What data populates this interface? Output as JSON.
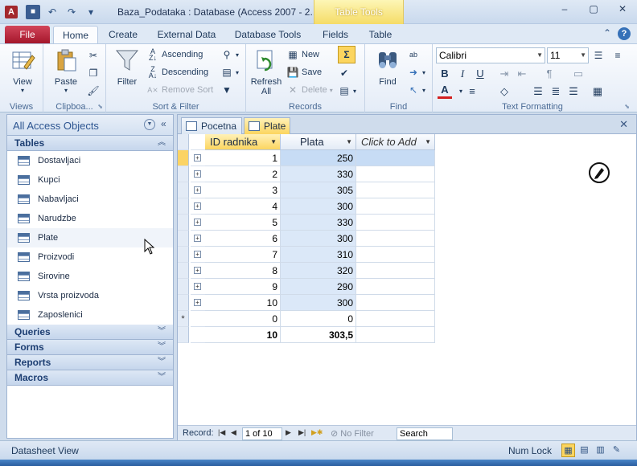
{
  "window": {
    "title": "Baza_Podataka : Database (Access 2007 - 2...",
    "context_tab_group": "Table Tools",
    "controls": {
      "minimize": "–",
      "maximize": "▢",
      "close": "✕"
    }
  },
  "qat": {
    "undo": "↶",
    "redo": "↷",
    "customize": "▾"
  },
  "ribbon_tabs": {
    "file": "File",
    "home": "Home",
    "create": "Create",
    "external_data": "External Data",
    "database_tools": "Database Tools",
    "fields": "Fields",
    "table": "Table"
  },
  "ribbon": {
    "views": {
      "view_label": "View",
      "group": "Views"
    },
    "clipboard": {
      "paste_label": "Paste",
      "group": "Clipboa..."
    },
    "sort_filter": {
      "filter_label": "Filter",
      "ascending": "Ascending",
      "descending": "Descending",
      "remove_sort": "Remove Sort",
      "group": "Sort & Filter"
    },
    "records": {
      "refresh_label": "Refresh",
      "refresh_sub": "All",
      "new": "New",
      "save": "Save",
      "delete": "Delete",
      "group": "Records"
    },
    "find": {
      "find_label": "Find",
      "group": "Find"
    },
    "text_formatting": {
      "font": "Calibri",
      "size": "11",
      "bold": "B",
      "italic": "I",
      "underline": "U",
      "font_color": "A",
      "group": "Text Formatting"
    }
  },
  "nav_pane": {
    "title": "All Access Objects",
    "collapse": "«",
    "sections": {
      "tables": "Tables",
      "queries": "Queries",
      "forms": "Forms",
      "reports": "Reports",
      "macros": "Macros"
    },
    "tables": [
      "Dostavljaci",
      "Kupci",
      "Nabavljaci",
      "Narudzbe",
      "Plate",
      "Proizvodi",
      "Sirovine",
      "Vrsta proizvoda",
      "Zaposlenici"
    ]
  },
  "doc_tabs": {
    "pocetna": "Pocetna",
    "plate": "Plate"
  },
  "datasheet": {
    "columns": {
      "id": "ID radnika",
      "plata": "Plata",
      "add": "Click to Add"
    },
    "rows": [
      {
        "id": "1",
        "plata": "250"
      },
      {
        "id": "2",
        "plata": "330"
      },
      {
        "id": "3",
        "plata": "305"
      },
      {
        "id": "4",
        "plata": "300"
      },
      {
        "id": "5",
        "plata": "330"
      },
      {
        "id": "6",
        "plata": "300"
      },
      {
        "id": "7",
        "plata": "310"
      },
      {
        "id": "8",
        "plata": "320"
      },
      {
        "id": "9",
        "plata": "290"
      },
      {
        "id": "10",
        "plata": "300"
      }
    ],
    "new_row": {
      "marker": "*",
      "id": "0",
      "plata": "0"
    },
    "total_row": {
      "id": "10",
      "plata": "303,5"
    }
  },
  "record_nav": {
    "label": "Record:",
    "position": "1 of 10",
    "no_filter": "No Filter",
    "search": "Search"
  },
  "status": {
    "left": "Datasheet View",
    "num_lock": "Num Lock"
  }
}
